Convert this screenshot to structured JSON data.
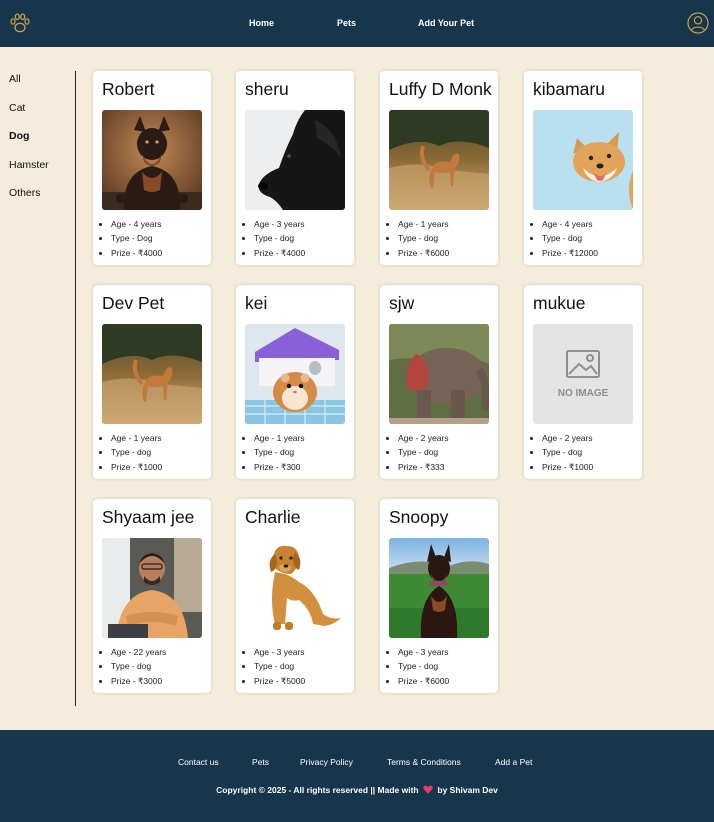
{
  "header": {
    "logo_icon": "paw-icon",
    "nav": [
      "Home",
      "Pets",
      "Add Your Pet"
    ],
    "user_icon": "user-circle-icon",
    "bg_color": "#17364b",
    "accent_color": "#c8a04a"
  },
  "sidebar": {
    "items": [
      "All",
      "Cat",
      "Dog",
      "Hamster",
      "Others"
    ],
    "selected": "Dog"
  },
  "pets": [
    {
      "name": "Robert",
      "image": "doberman-photo",
      "age": "Age - 4 years",
      "type": "Type - Dog",
      "prize": "Prize - ₹4000"
    },
    {
      "name": "sheru",
      "image": "black-dog-photo",
      "age": "Age - 3 years",
      "type": "Type - dog",
      "prize": "Prize - ₹4000"
    },
    {
      "name": "Luffy D Monk",
      "image": "golden-dog-field-photo",
      "age": "Age - 1 years",
      "type": "Type - dog",
      "prize": "Prize - ₹6000"
    },
    {
      "name": "kibamaru",
      "image": "shiba-inu-photo",
      "age": "Age - 4 years",
      "type": "Type - dog",
      "prize": "Prize - ₹12000"
    },
    {
      "name": "Dev Pet",
      "image": "golden-dog-field-photo",
      "age": "Age - 1 years",
      "type": "Type - dog",
      "prize": "Prize - ₹1000"
    },
    {
      "name": "kei",
      "image": "hamster-photo",
      "age": "Age - 1 years",
      "type": "Type - dog",
      "prize": "Prize - ₹300"
    },
    {
      "name": "sjw",
      "image": "elephant-photo",
      "age": "Age - 2 years",
      "type": "Type - dog",
      "prize": "Prize - ₹333"
    },
    {
      "name": "mukue",
      "image": "no-image-placeholder",
      "image_text": "NO IMAGE",
      "age": "Age - 2 years",
      "type": "Type - dog",
      "prize": "Prize - ₹1000"
    },
    {
      "name": "Shyaam jee",
      "image": "man-photo",
      "age": "Age - 22 years",
      "type": "Type - dog",
      "prize": "Prize - ₹3000"
    },
    {
      "name": "Charlie",
      "image": "golden-retriever-photo",
      "age": "Age - 3 years",
      "type": "Type - dog",
      "prize": "Prize - ₹5000"
    },
    {
      "name": "Snoopy",
      "image": "doberman-grass-photo",
      "age": "Age - 3 years",
      "type": "Type - dog",
      "prize": "Prize - ₹6000"
    }
  ],
  "footer": {
    "links": [
      "Contact us",
      "Pets",
      "Privacy Policy",
      "Terms & Conditions",
      "Add a Pet"
    ],
    "copyright_prefix": "Copyright © 2025 - All rights reserved || Made with",
    "heart_icon": "heart-icon",
    "copyright_suffix": "by Shivam Dev",
    "heart_color": "#e23e6b"
  }
}
